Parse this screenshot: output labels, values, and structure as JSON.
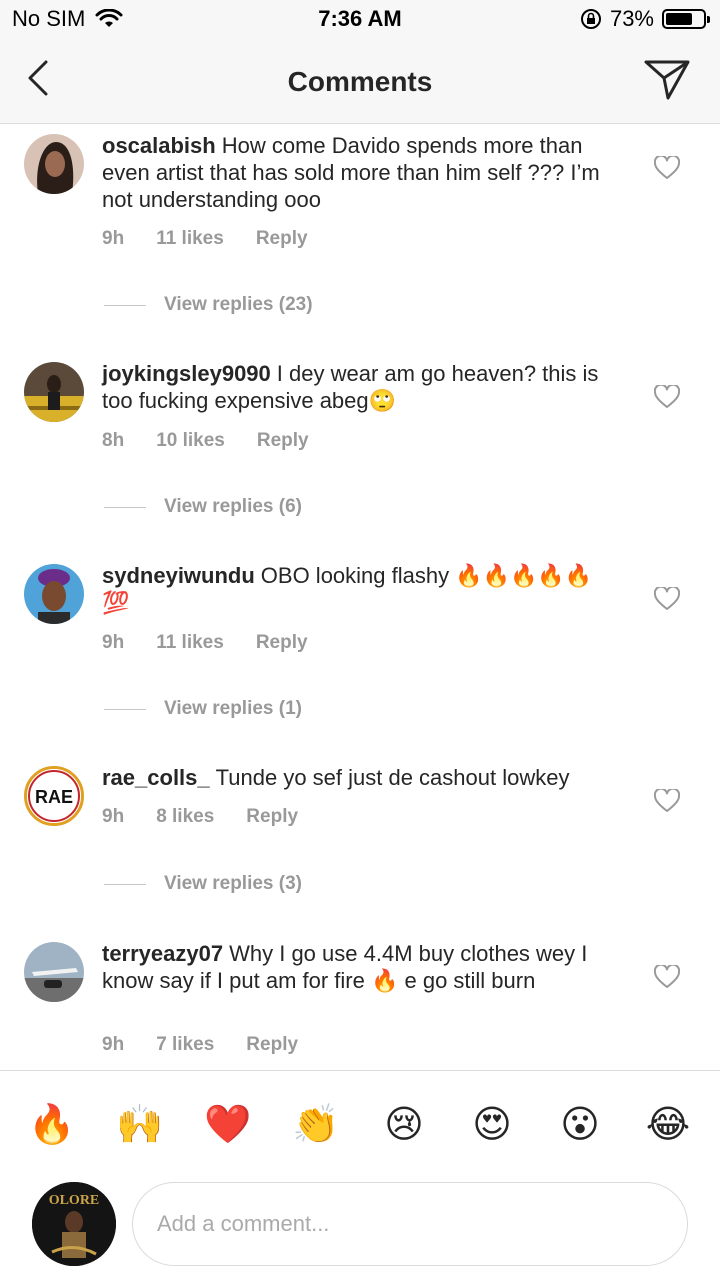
{
  "status_bar": {
    "carrier": "No SIM",
    "time": "7:36 AM",
    "battery": "73%",
    "battery_level": 0.73
  },
  "nav": {
    "title": "Comments",
    "back_icon": "chevron-left-icon",
    "send_icon": "paper-plane-icon"
  },
  "comments": [
    {
      "username": "oscalabish",
      "text": "How come Davido spends more than even artist that has sold more than him self ??? I’m not understanding ooo",
      "time": "9h",
      "likes": "11 likes",
      "reply": "Reply",
      "view_replies": "View replies (23)"
    },
    {
      "username": "joykingsley9090",
      "text": "I dey wear am go heaven? this is too fucking expensive abeg🙄",
      "time": "8h",
      "likes": "10 likes",
      "reply": "Reply",
      "view_replies": "View replies (6)"
    },
    {
      "username": "sydneyiwundu",
      "text": "OBO looking flashy 🔥🔥🔥🔥🔥💯",
      "time": "9h",
      "likes": "11 likes",
      "reply": "Reply",
      "view_replies": "View replies (1)"
    },
    {
      "username": "rae_colls_",
      "text": "Tunde yo sef just de cashout lowkey",
      "time": "9h",
      "likes": "8 likes",
      "reply": "Reply",
      "view_replies": "View replies (3)",
      "avatar_text": "RAE"
    },
    {
      "username": "terryeazy07",
      "text": "Why I go use 4.4M buy clothes wey I know say if I put am for fire 🔥 e go still burn",
      "time": "9h",
      "likes": "7 likes",
      "reply": "Reply"
    }
  ],
  "emoji_bar": [
    "🔥",
    "🙌",
    "❤️",
    "👏",
    "😢",
    "😍",
    "😮",
    "😂"
  ],
  "composer": {
    "placeholder": "Add a comment...",
    "avatar_text": "OLORE"
  }
}
